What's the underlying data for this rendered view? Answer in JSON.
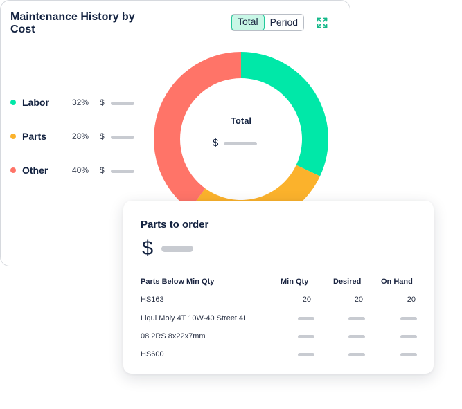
{
  "maintenance": {
    "title": "Maintenance History by Cost",
    "toggle": {
      "total_label": "Total",
      "period_label": "Period",
      "selected": "Total"
    },
    "expand_icon": "expand-arrows-icon",
    "legend": [
      {
        "label": "Labor",
        "percent": "32%",
        "currency": "$",
        "color": "#00e8a8"
      },
      {
        "label": "Parts",
        "percent": "28%",
        "currency": "$",
        "color": "#fbb22c"
      },
      {
        "label": "Other",
        "percent": "40%",
        "currency": "$",
        "color": "#ff7468"
      }
    ],
    "donut": {
      "center_label": "Total",
      "center_currency": "$"
    }
  },
  "chart_data": {
    "type": "pie",
    "categories": [
      "Labor",
      "Parts",
      "Other"
    ],
    "values": [
      32,
      28,
      40
    ],
    "colors": [
      "#00e8a8",
      "#fbb22c",
      "#ff7468"
    ],
    "start_angle_deg": 0,
    "direction": "clockwise",
    "donut": true
  },
  "parts_to_order": {
    "title": "Parts to order",
    "currency": "$",
    "columns": {
      "name": "Parts Below Min Qty",
      "min_qty": "Min Qty",
      "desired": "Desired",
      "on_hand": "On Hand"
    },
    "rows": [
      {
        "name": "HS163",
        "min_qty": "20",
        "desired": "20",
        "on_hand": "20"
      },
      {
        "name": "Liqui Moly 4T 10W-40 Street 4L",
        "min_qty": null,
        "desired": null,
        "on_hand": null
      },
      {
        "name": "08 2RS 8x22x7mm",
        "min_qty": null,
        "desired": null,
        "on_hand": null
      },
      {
        "name": "HS600",
        "min_qty": null,
        "desired": null,
        "on_hand": null
      }
    ]
  }
}
